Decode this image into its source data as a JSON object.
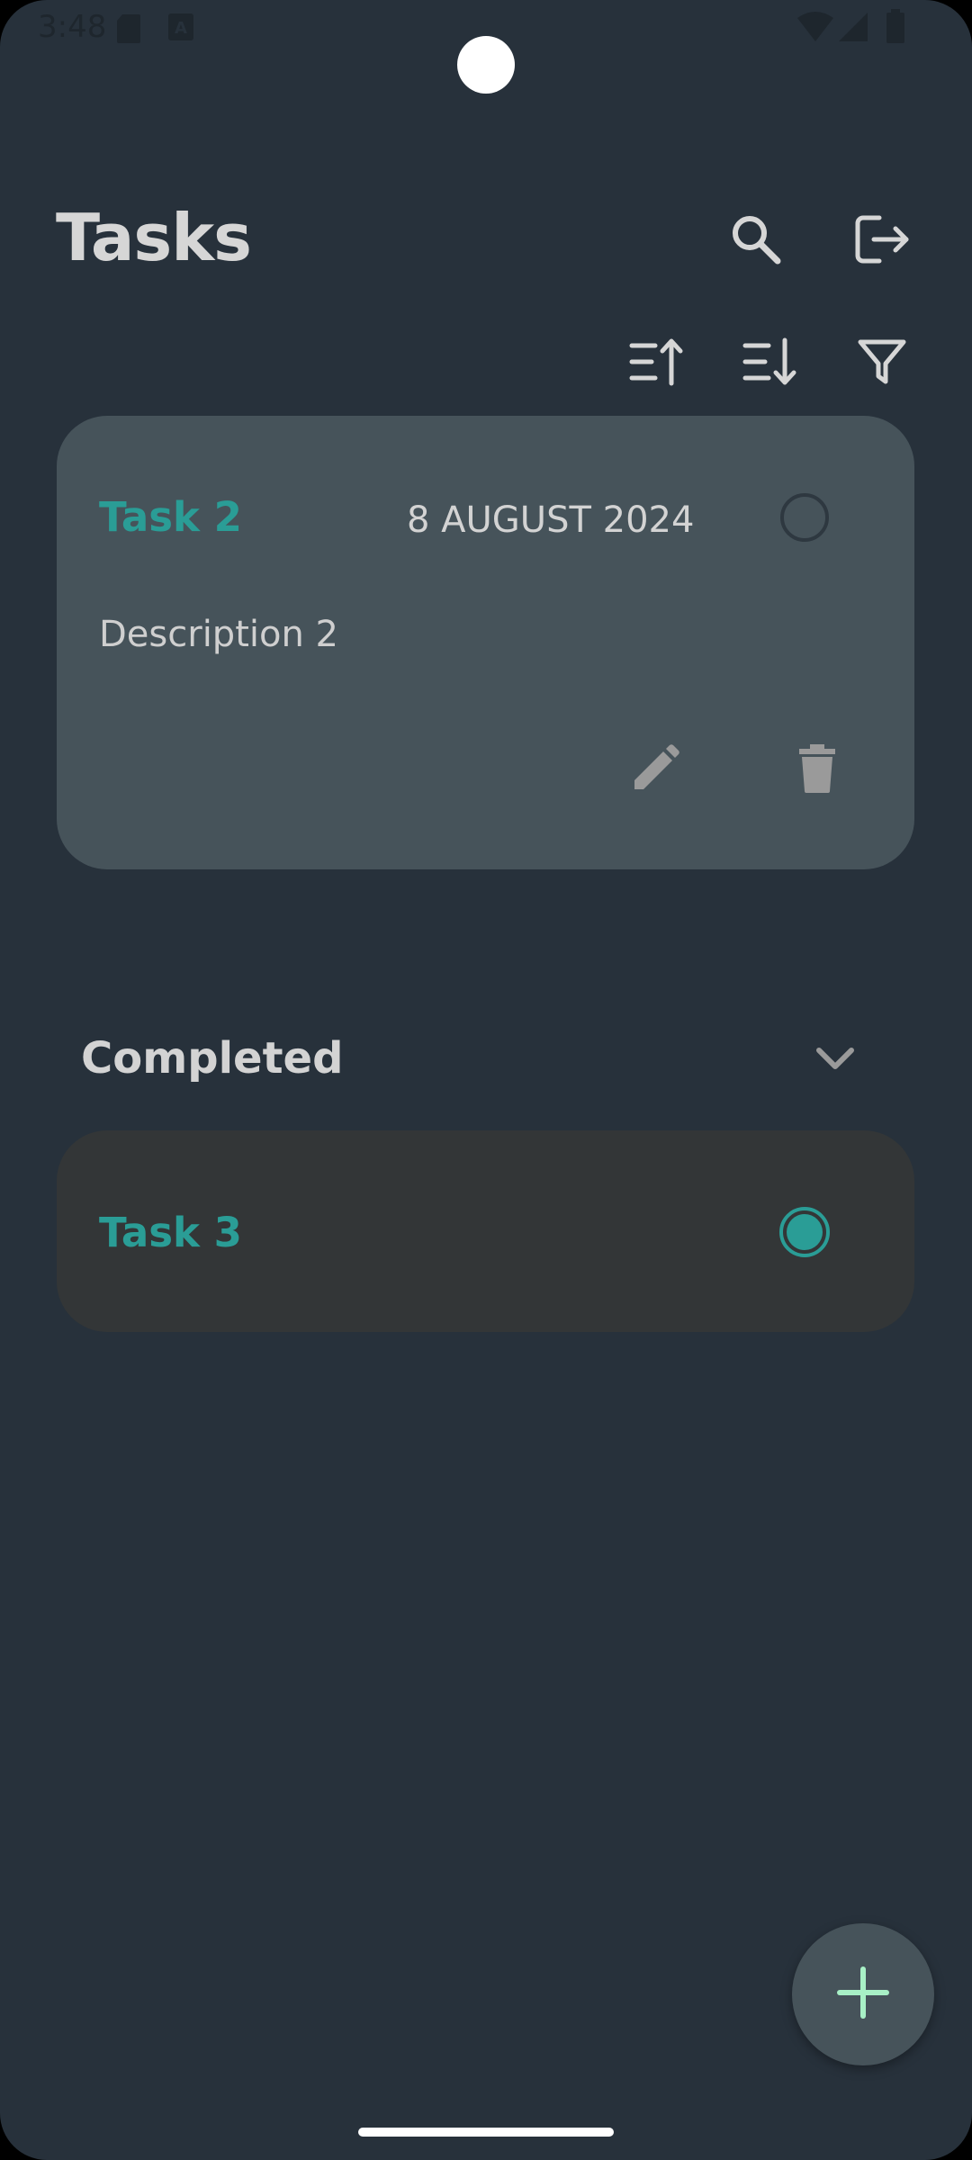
{
  "status_bar": {
    "time": "3:48"
  },
  "header": {
    "title": "Tasks"
  },
  "toolbar": {
    "search_icon": "search-icon",
    "logout_icon": "logout-icon",
    "sort_asc_icon": "sort-ascending-icon",
    "sort_desc_icon": "sort-descending-icon",
    "filter_icon": "filter-icon"
  },
  "tasks": [
    {
      "title": "Task 2",
      "date": "8 AUGUST 2024",
      "description": "Description 2",
      "completed": false
    }
  ],
  "completed_section": {
    "title": "Completed",
    "tasks": [
      {
        "title": "Task 3",
        "completed": true
      }
    ]
  },
  "colors": {
    "background": "#27313B",
    "card": "#46535A",
    "completed_card": "#333637",
    "accent": "#2A9D96",
    "fab_plus": "#A8F0C6"
  }
}
